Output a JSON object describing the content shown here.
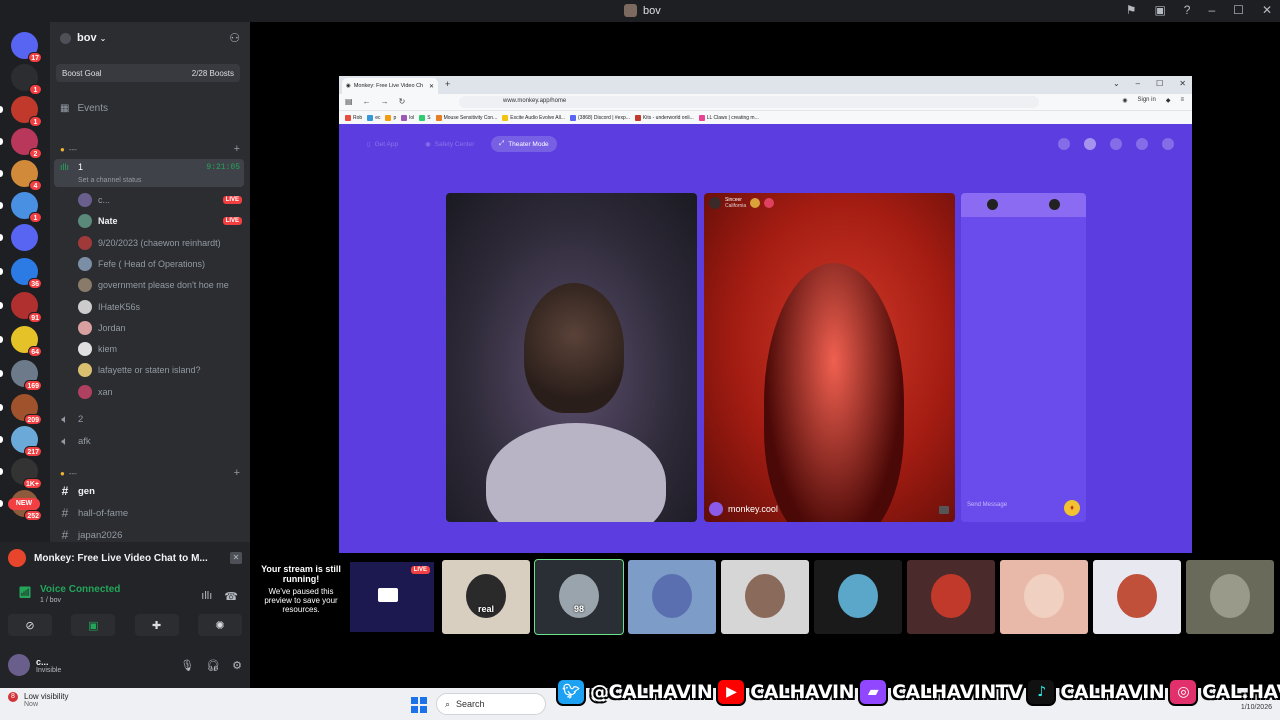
{
  "titlebar": {
    "title": "bov"
  },
  "servers": [
    {
      "name": "discord-home",
      "badge": "17",
      "color": "#5865f2"
    },
    {
      "name": "add-server",
      "badge": "1",
      "color": "#2b2d31"
    },
    {
      "name": "server-2",
      "badge": "1",
      "color": "#c0392b"
    },
    {
      "name": "server-3",
      "badge": "2",
      "color": "#b9375a"
    },
    {
      "name": "server-4",
      "badge": "4",
      "color": "#d08a3a"
    },
    {
      "name": "server-5",
      "badge": "1",
      "color": "#4a90e2"
    },
    {
      "name": "folder",
      "badge": "",
      "color": "#5865f2"
    },
    {
      "name": "server-7",
      "badge": "36",
      "color": "#2c7be5"
    },
    {
      "name": "server-8",
      "badge": "91",
      "color": "#b03030"
    },
    {
      "name": "server-9",
      "badge": "64",
      "color": "#e6c229"
    },
    {
      "name": "server-10",
      "badge": "169",
      "color": "#6c7a89"
    },
    {
      "name": "server-11",
      "badge": "209",
      "color": "#a0522d"
    },
    {
      "name": "server-12",
      "badge": "217",
      "color": "#6aa9d8"
    },
    {
      "name": "server-13",
      "badge": "1K+",
      "color": "#333333"
    },
    {
      "name": "server-14",
      "badge": "252",
      "color": "#8e5a3c"
    }
  ],
  "rail_new": "NEW",
  "sidebar": {
    "server_name": "bov",
    "boost_label": "Boost Goal",
    "boost_count": "2/28 Boosts",
    "events": "Events",
    "category1": "---",
    "active_channel": {
      "name": "1",
      "time": "9:21:05",
      "status": "Set a channel status"
    },
    "members": [
      {
        "name": "c...",
        "live": "LIVE",
        "color": "#6a5e8c",
        "bright": false
      },
      {
        "name": "Nate",
        "live": "LIVE",
        "color": "#5b8a7a",
        "bright": true
      },
      {
        "name": "9/20/2023 (chaewon reinhardt)",
        "live": "",
        "color": "#a03a3a",
        "bright": false
      },
      {
        "name": "Fefe ( Head of Operations)",
        "live": "",
        "color": "#7a8fa6",
        "bright": false
      },
      {
        "name": "government please don't hoe me",
        "live": "",
        "color": "#8a7a6a",
        "bright": false
      },
      {
        "name": "IHateK56s",
        "live": "",
        "color": "#cccccc",
        "bright": false
      },
      {
        "name": "Jordan",
        "live": "",
        "color": "#d9a0a0",
        "bright": false
      },
      {
        "name": "kiem",
        "live": "",
        "color": "#e0e0e0",
        "bright": false
      },
      {
        "name": "lafayette or staten island?",
        "live": "",
        "color": "#d8c070",
        "bright": false
      },
      {
        "name": "xan",
        "live": "",
        "color": "#b04060",
        "bright": false
      }
    ],
    "voice_channels": [
      "2",
      "afk"
    ],
    "category2": "---",
    "text_channels": [
      "gen",
      "hall-of-fame",
      "japan2026"
    ]
  },
  "panel": {
    "stream_title": "Monkey: Free Live Video Chat to M...",
    "voice_status": "Voice Connected",
    "voice_channel": "1 / bov",
    "user_name": "c...",
    "user_status": "Invisible"
  },
  "browser": {
    "tab_title": "Monkey: Free Live Video Ch",
    "url": "www.monkey.app/home",
    "signin": "Sign in",
    "bookmarks": [
      "Rob",
      "ec",
      "p",
      "lol",
      "S",
      "Mouse Sensitivity Con...",
      "Excite Audio Evolve All...",
      "(3868) Discord | #exp...",
      "Kits - underworld onli...",
      "LL Claws | creating m..."
    ],
    "pills": [
      "Get App",
      "Safety Center",
      "Theater Mode"
    ],
    "cam_name": "Sinceer",
    "cam_location": "California",
    "cam_brand": "monkey.cool",
    "send_placeholder": "Send Message"
  },
  "strip": {
    "paused_head": "Your stream is still running!",
    "paused_body": "We've paused this preview to save your resources.",
    "live": "LIVE",
    "tiles": [
      {
        "bg": "#d8cfc0",
        "face": "#2a2a2a",
        "label": "real"
      },
      {
        "bg": "#2a2f35",
        "face": "#9aa4ac",
        "label": "98"
      },
      {
        "bg": "#7d9cc7",
        "face": "#5a6fb0",
        "label": ""
      },
      {
        "bg": "#d6d6d6",
        "face": "#8a6a5a",
        "label": ""
      },
      {
        "bg": "#1a1a1a",
        "face": "#5aa7c9",
        "label": ""
      },
      {
        "bg": "#4a2a2a",
        "face": "#c0392b",
        "label": ""
      },
      {
        "bg": "#e8b8a8",
        "face": "#f0d0c0",
        "label": ""
      },
      {
        "bg": "#e8e8f0",
        "face": "#c0503a",
        "label": ""
      },
      {
        "bg": "#6a6a5a",
        "face": "#9a9a8a",
        "label": ""
      }
    ]
  },
  "taskbar": {
    "notif_badge": "8",
    "notif_title": "Low visibility",
    "notif_sub": "Now",
    "search": "Search",
    "date": "1/10/2026"
  },
  "social": {
    "twitter": "@CALHAVIN",
    "youtube": "CALHAVIN",
    "twitch": "CALHAVINTV",
    "tiktok": "CALHAVIN",
    "instagram": "CAL.HAVIN"
  }
}
